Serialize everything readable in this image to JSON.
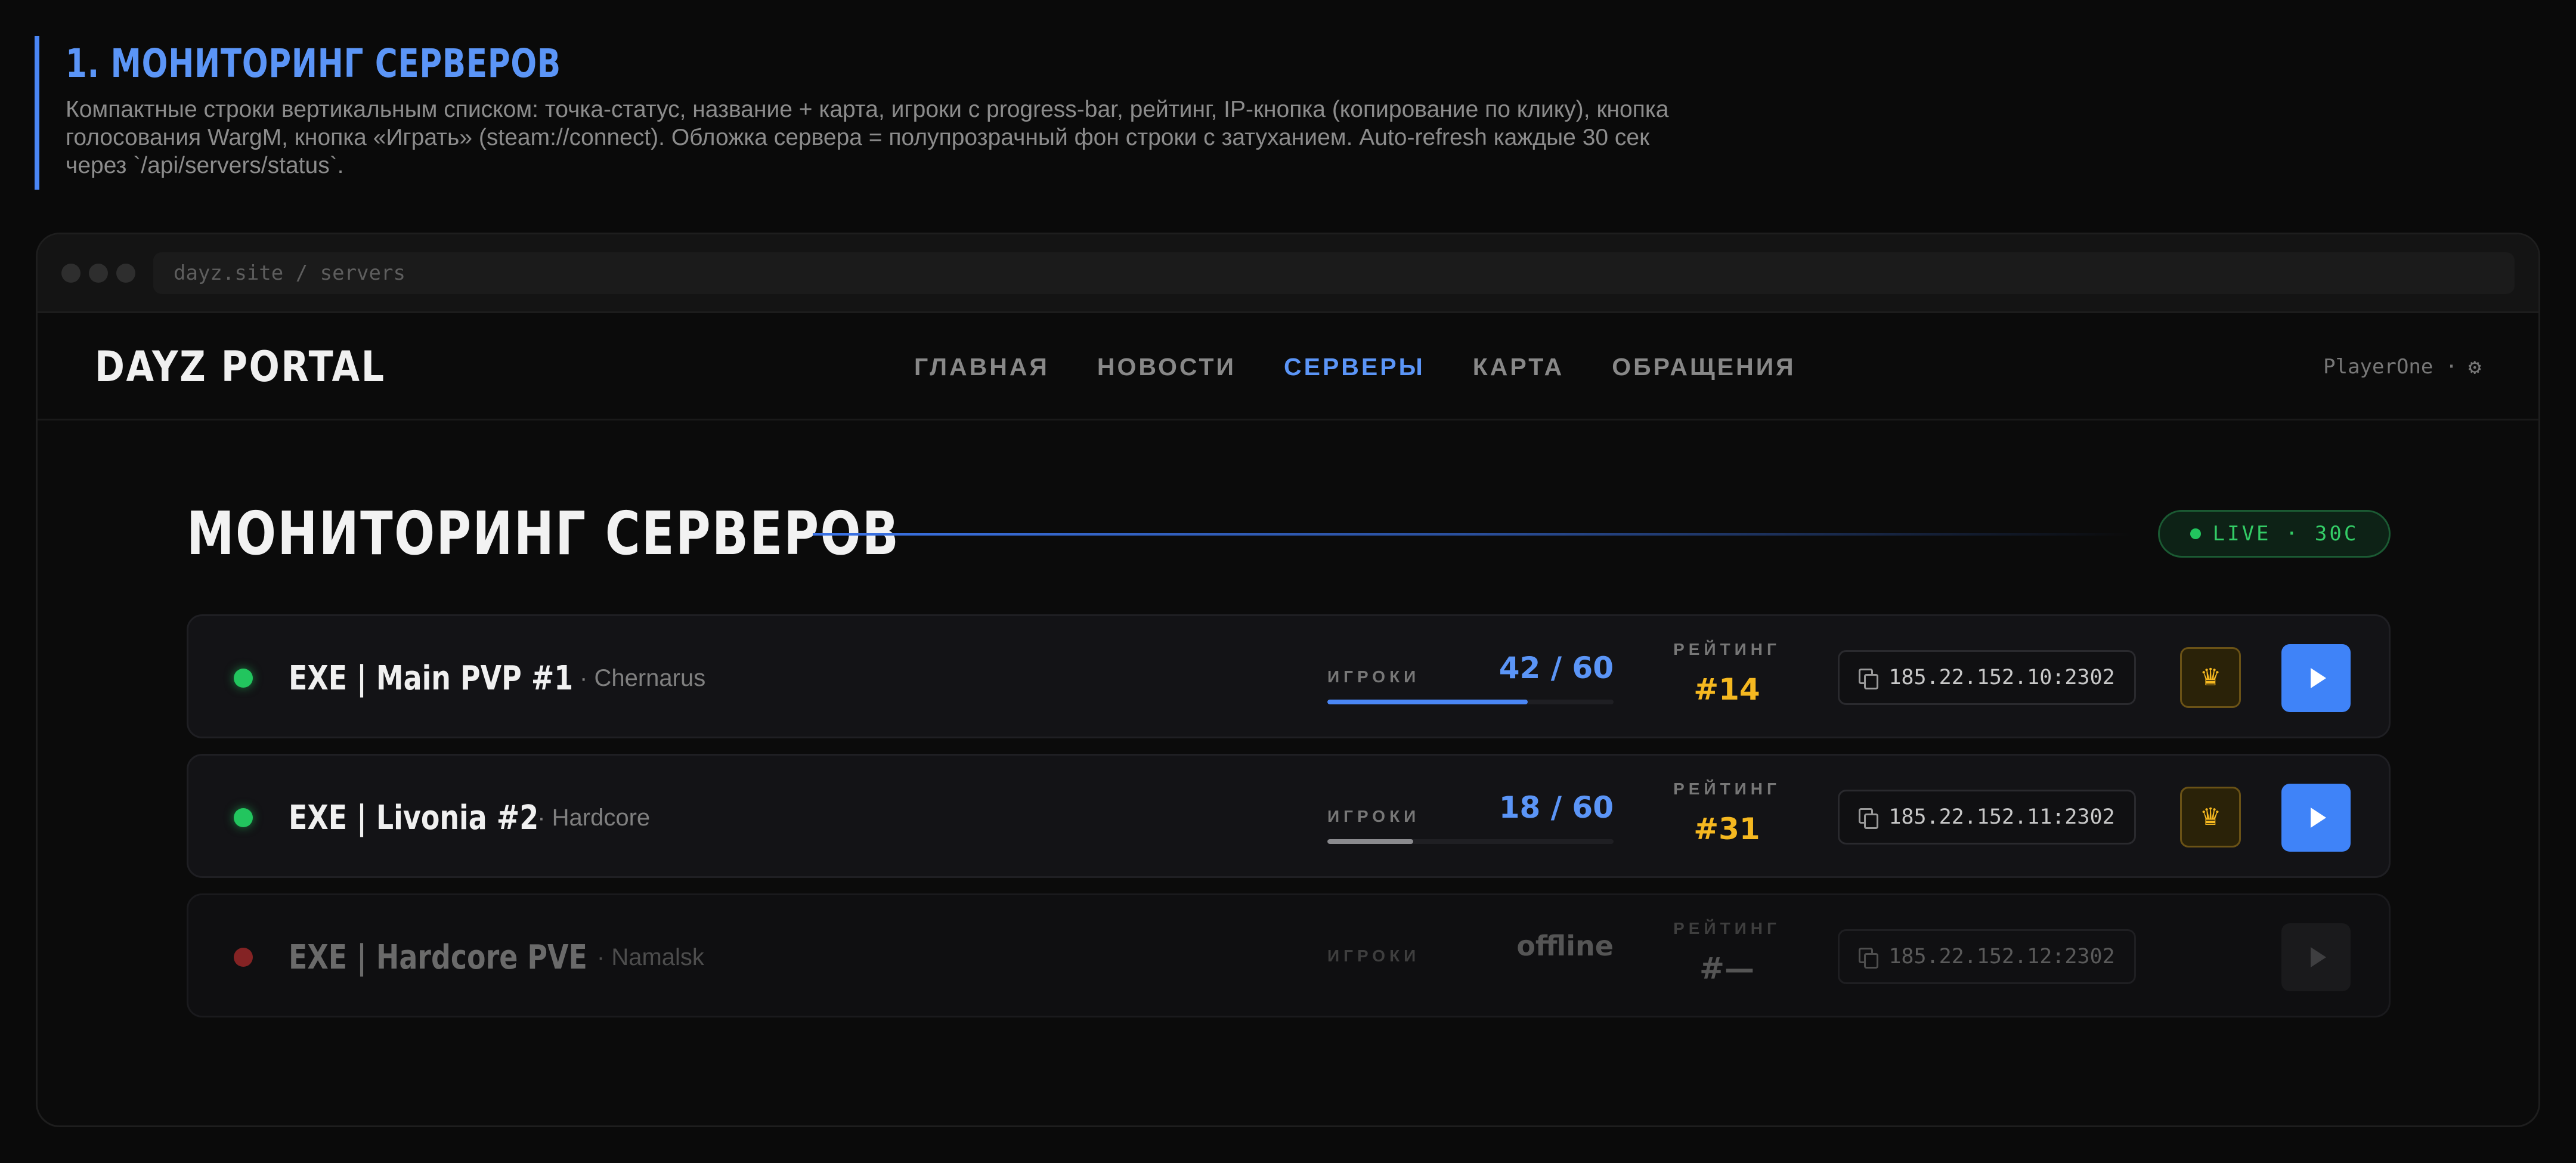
{
  "annotation": {
    "title": "1. МОНИТОРИНГ СЕРВЕРОВ",
    "description": "Компактные строки вертикальным списком: точка-статус, название + карта, игроки с progress-bar, рейтинг, IP-кнопка (копирование по клику), кнопка голосования WargM, кнопка «Играть» (steam://connect). Обложка сервера = полупрозрачный фон строки с затуханием. Auto-refresh каждые 30 сек через `/api/servers/status`."
  },
  "browser": {
    "url": "dayz.site / servers"
  },
  "nav": {
    "brand": "DAYZ PORTAL",
    "items": [
      {
        "label": "ГЛАВНАЯ",
        "active": false
      },
      {
        "label": "НОВОСТИ",
        "active": false
      },
      {
        "label": "СЕРВЕРЫ",
        "active": true
      },
      {
        "label": "КАРТА",
        "active": false
      },
      {
        "label": "ОБРАЩЕНИЯ",
        "active": false
      }
    ],
    "user": "PlayerOne ·",
    "user_icon": "gear-icon"
  },
  "page": {
    "title": "МОНИТОРИНГ СЕРВЕРОВ",
    "live_badge": "LIVE · 30С"
  },
  "labels": {
    "players": "ИГРОКИ",
    "rating": "РЕЙТИНГ"
  },
  "colors": {
    "accent": "#3f83f8",
    "online": "#22c55e",
    "offline": "#b62c2c",
    "rating": "#f5b820",
    "players_full_fill": "#4a86f5",
    "players_low_fill": "#8a8a8e"
  },
  "servers": [
    {
      "status": "online",
      "name": "EXE | Main PVP #1",
      "map": "· Chernarus",
      "players": "42 / 60",
      "fill": 0.7,
      "fill_color": "#4a86f5",
      "rating": "#14",
      "ip": "185.22.152.10:2302",
      "vote": true,
      "play": true
    },
    {
      "status": "online",
      "name": "EXE | Livonia #2",
      "map": "· Hardcore",
      "players": "18 / 60",
      "fill": 0.3,
      "fill_color": "#8a8a8e",
      "rating": "#31",
      "ip": "185.22.152.11:2302",
      "vote": true,
      "play": true
    },
    {
      "status": "offline",
      "name": "EXE | Hardcore PVE",
      "map": "· Namalsk",
      "players": "offline",
      "fill": 0,
      "fill_color": "#555555",
      "rating": "#—",
      "ip": "185.22.152.12:2302",
      "vote": false,
      "play": false
    }
  ]
}
